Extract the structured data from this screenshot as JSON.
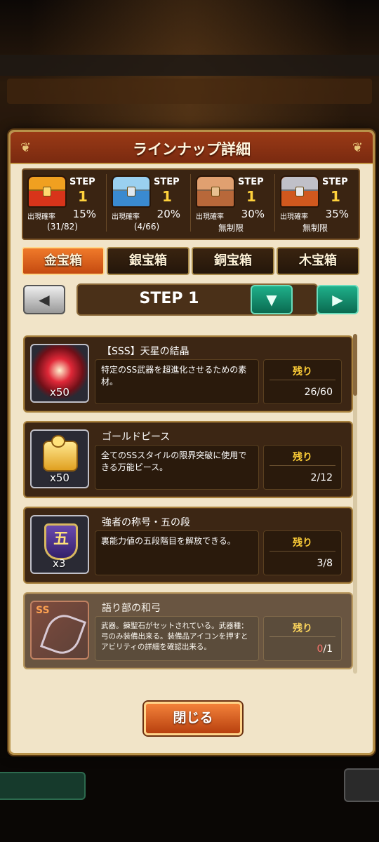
{
  "dialog": {
    "title": "ラインナップ詳細"
  },
  "chests": [
    {
      "step_label": "STEP",
      "step_value": "1",
      "rate_label": "出現確率",
      "rate_value": "15%",
      "sub": "(31/82)",
      "color": "#d8341a"
    },
    {
      "step_label": "STEP",
      "step_value": "1",
      "rate_label": "出現確率",
      "rate_value": "20%",
      "sub": "(4/66)",
      "color": "#3a8ad0"
    },
    {
      "step_label": "STEP",
      "step_value": "1",
      "rate_label": "出現確率",
      "rate_value": "30%",
      "sub": "無制限",
      "color": "#b8683a"
    },
    {
      "step_label": "STEP",
      "step_value": "1",
      "rate_label": "出現確率",
      "rate_value": "35%",
      "sub": "無制限",
      "color": "#d0581e"
    }
  ],
  "tabs": [
    {
      "label": "金宝箱",
      "active": true
    },
    {
      "label": "銀宝箱",
      "active": false
    },
    {
      "label": "銅宝箱",
      "active": false
    },
    {
      "label": "木宝箱",
      "active": false
    }
  ],
  "step_selector": {
    "label": "STEP 1"
  },
  "items": [
    {
      "name": "【SSS】天星の結晶",
      "qty": "x50",
      "desc": "特定のSS武器を超進化させるための素材。",
      "remain_label": "残り",
      "remain_value": "26/60",
      "icon": "red-crystal-icon"
    },
    {
      "name": "ゴールドピース",
      "qty": "x50",
      "desc": "全てのSSスタイルの限界突破に使用できる万能ピース。",
      "remain_label": "残り",
      "remain_value": "2/12",
      "icon": "gold-puzzle-piece-icon"
    },
    {
      "name": "強者の称号・五の段",
      "qty": "x3",
      "desc": "裏能力値の五段階目を解放できる。",
      "remain_label": "残り",
      "remain_value": "3/8",
      "icon": "rank-emblem-icon"
    },
    {
      "name": "語り部の和弓",
      "qty": "",
      "desc": "武器。錬聖石がセットされている。武器種：弓のみ装備出来る。装備品アイコンを押すとアビリティの詳細を確認出来る。",
      "remain_label": "残り",
      "remain_zero": "0",
      "remain_total": "/1",
      "icon": "bow-weapon-icon"
    }
  ],
  "close_button": {
    "label": "閉じる"
  }
}
